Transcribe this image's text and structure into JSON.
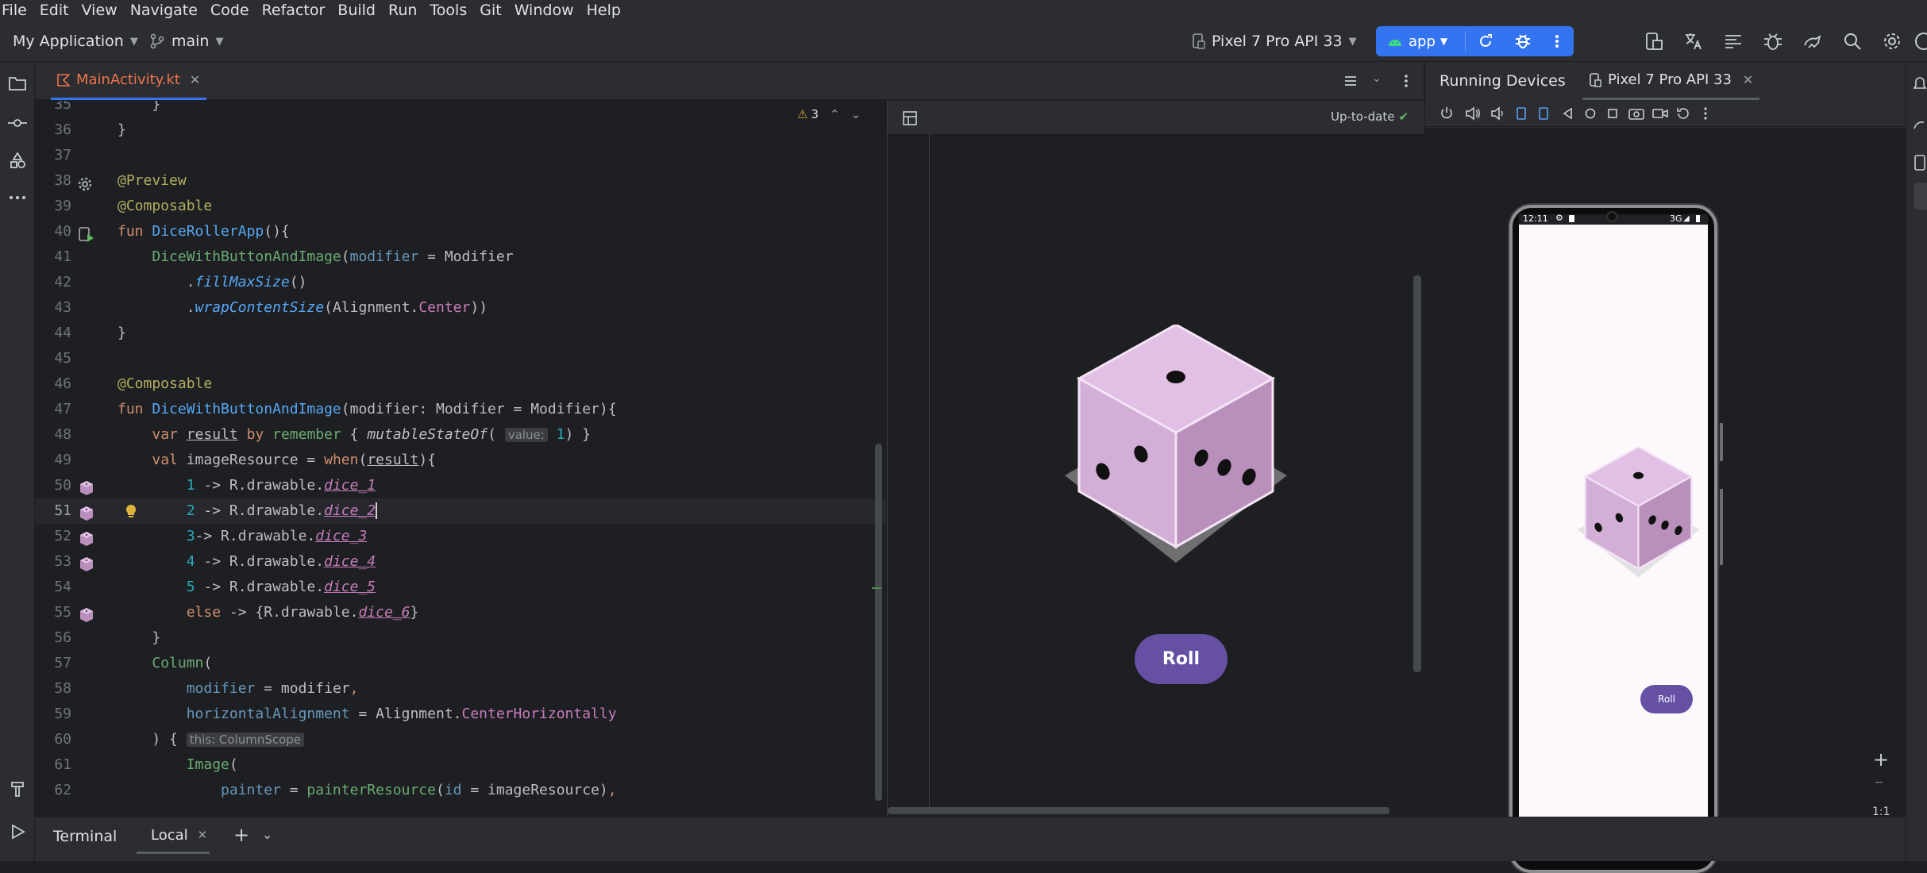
{
  "menu": [
    "File",
    "Edit",
    "View",
    "Navigate",
    "Code",
    "Refactor",
    "Build",
    "Run",
    "Tools",
    "Git",
    "Window",
    "Help"
  ],
  "toolbar": {
    "project": "My Application",
    "branch": "main",
    "device": "Pixel 7 Pro API 33",
    "run_config": "app"
  },
  "editor": {
    "tab": "MainActivity.kt",
    "warnings": "3",
    "lines": [
      {
        "n": "35",
        "t": "    }"
      },
      {
        "n": "36",
        "t": "}"
      },
      {
        "n": "37",
        "t": ""
      },
      {
        "n": "38",
        "t": "@Preview"
      },
      {
        "n": "39",
        "t": "@Composable"
      },
      {
        "n": "40",
        "t": "fun DiceRollerApp(){"
      },
      {
        "n": "41",
        "t": "    DiceWithButtonAndImage(modifier = Modifier"
      },
      {
        "n": "42",
        "t": "        .fillMaxSize()"
      },
      {
        "n": "43",
        "t": "        .wrapContentSize(Alignment.Center))"
      },
      {
        "n": "44",
        "t": "}"
      },
      {
        "n": "45",
        "t": ""
      },
      {
        "n": "46",
        "t": "@Composable"
      },
      {
        "n": "47",
        "t": "fun DiceWithButtonAndImage(modifier: Modifier = Modifier){"
      },
      {
        "n": "48",
        "t": "    var result by remember { mutableStateOf( value: 1) }"
      },
      {
        "n": "49",
        "t": "    val imageResource = when(result){"
      },
      {
        "n": "50",
        "t": "        1 -> R.drawable.dice_1"
      },
      {
        "n": "51",
        "t": "        2 -> R.drawable.dice_2"
      },
      {
        "n": "52",
        "t": "        3-> R.drawable.dice_3"
      },
      {
        "n": "53",
        "t": "        4 -> R.drawable.dice_4"
      },
      {
        "n": "54",
        "t": "        5 -> R.drawable.dice_5"
      },
      {
        "n": "55",
        "t": "        else -> {R.drawable.dice_6}"
      },
      {
        "n": "56",
        "t": "    }"
      },
      {
        "n": "57",
        "t": "    Column("
      },
      {
        "n": "58",
        "t": "        modifier = modifier,"
      },
      {
        "n": "59",
        "t": "        horizontalAlignment = Alignment.CenterHorizontally"
      },
      {
        "n": "60",
        "t": "    ) { this: ColumnScope"
      },
      {
        "n": "61",
        "t": "        Image("
      },
      {
        "n": "62",
        "t": "            painter = painterResource(id = imageResource),"
      }
    ]
  },
  "preview": {
    "status": "Up-to-date",
    "button": "Roll"
  },
  "devices": {
    "panel_title": "Running Devices",
    "device_tab": "Pixel 7 Pro API 33",
    "phone_time": "12:11",
    "phone_network": "3G",
    "phone_button": "Roll",
    "zoom_label": "1:1"
  },
  "bottom": {
    "terminal": "Terminal",
    "local": "Local"
  },
  "colors": {
    "accent": "#3574f0",
    "button_purple": "#6650a4",
    "dice_top": "#e2bfe5",
    "dice_side": "#b98fbc"
  }
}
